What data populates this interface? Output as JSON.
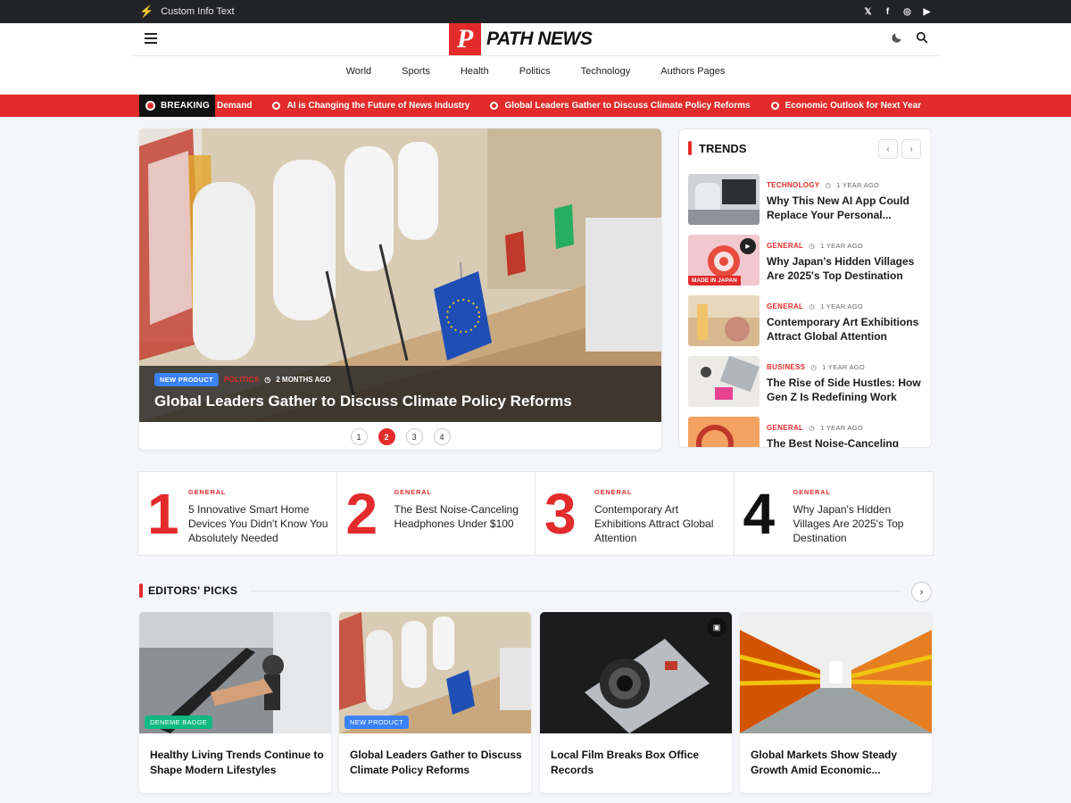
{
  "topbar": {
    "info_text": "Custom Info Text",
    "social": [
      "x-icon",
      "facebook-icon",
      "instagram-icon",
      "youtube-icon"
    ]
  },
  "header": {
    "logo_letter": "P",
    "logo_text": "PATH NEWS",
    "nav": [
      "World",
      "Sports",
      "Health",
      "Politics",
      "Technology",
      "Authors Pages"
    ]
  },
  "breaking": {
    "label": "BREAKING",
    "items": [
      "Demand",
      "AI is Changing the Future of News Industry",
      "Global Leaders Gather to Discuss Climate Policy Reforms",
      "Economic Outlook for Next Year"
    ]
  },
  "hero": {
    "badge": "NEW PRODUCT",
    "category": "POLITICS",
    "time": "2 MONTHS AGO",
    "title": "Global Leaders Gather to Discuss Climate Policy Reforms",
    "pages": [
      "1",
      "2",
      "3",
      "4"
    ],
    "active_page": "2"
  },
  "trends": {
    "heading": "TRENDS",
    "items": [
      {
        "category": "TECHNOLOGY",
        "time": "1 YEAR AGO",
        "title": "Why This New AI App Could Replace Your Personal..."
      },
      {
        "category": "GENERAL",
        "time": "1 YEAR AGO",
        "title": "Why Japan's Hidden Villages Are 2025's Top Destination",
        "thumb_label": "MADE IN JAPAN"
      },
      {
        "category": "GENERAL",
        "time": "1 YEAR AGO",
        "title": "Contemporary Art Exhibitions Attract Global Attention"
      },
      {
        "category": "BUSINESS",
        "time": "1 YEAR AGO",
        "title": "The Rise of Side Hustles: How Gen Z Is Redefining Work"
      },
      {
        "category": "GENERAL",
        "time": "1 YEAR AGO",
        "title": "The Best Noise-Canceling"
      }
    ]
  },
  "numbered": [
    {
      "num": "1",
      "category": "GENERAL",
      "title": "5 Innovative Smart Home Devices You Didn't Know You Absolutely Needed"
    },
    {
      "num": "2",
      "category": "GENERAL",
      "title": "The Best Noise-Canceling Headphones Under $100"
    },
    {
      "num": "3",
      "category": "GENERAL",
      "title": "Contemporary Art Exhibitions Attract Global Attention"
    },
    {
      "num": "4",
      "category": "GENERAL",
      "title": "Why Japan's Hidden Villages Are 2025's Top Destination"
    }
  ],
  "editors_picks": {
    "heading": "EDITORS' PICKS",
    "cards": [
      {
        "badge": "DENEME BADGE",
        "title": "Healthy Living Trends Continue to Shape Modern Lifestyles"
      },
      {
        "badge": "NEW PRODUCT",
        "title": "Global Leaders Gather to Discuss Climate Policy Reforms"
      },
      {
        "badge": "",
        "title": "Local Film Breaks Box Office Records"
      },
      {
        "badge": "",
        "title": "Global Markets Show Steady Growth Amid Economic..."
      }
    ]
  },
  "colors": {
    "accent": "#e32b2b",
    "dark": "#222326",
    "badge_blue": "#3b82f6",
    "badge_green": "#10b981"
  }
}
